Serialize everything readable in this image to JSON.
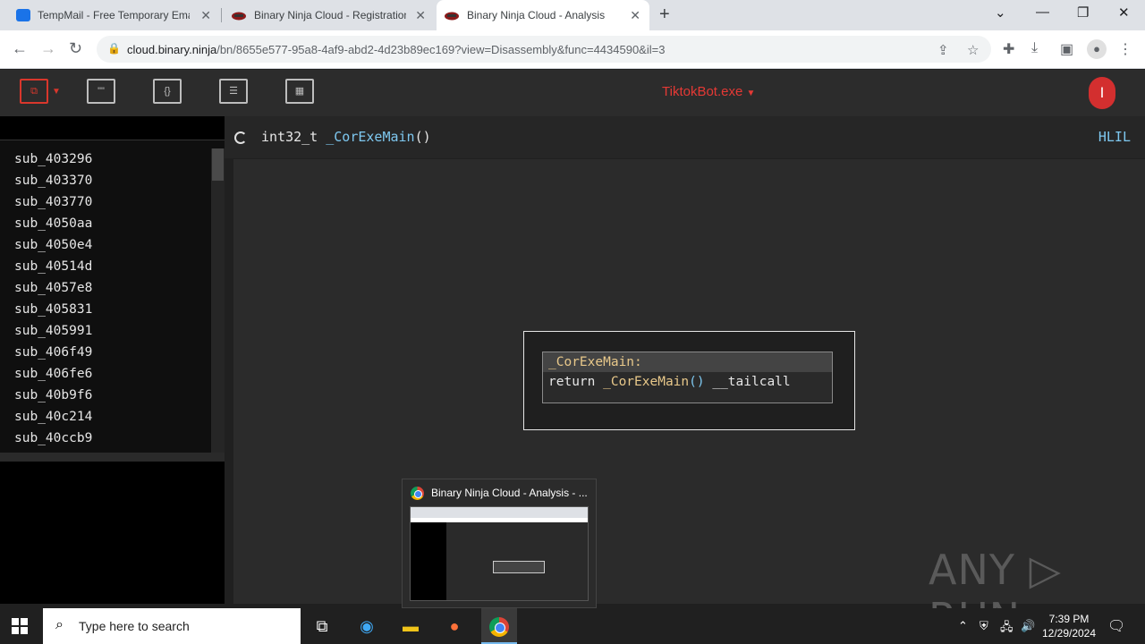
{
  "browser": {
    "tabs": [
      {
        "title": "TempMail - Free Temporary Ema",
        "icon": "mail-icon"
      },
      {
        "title": "Binary Ninja Cloud - Registration",
        "icon": "binja-icon"
      },
      {
        "title": "Binary Ninja Cloud - Analysis",
        "icon": "binja-icon",
        "active": true
      }
    ],
    "url_host": "cloud.binary.ninja",
    "url_path": "/bn/8655e577-95a8-4af9-abd2-4d23b89ec169?view=Disassembly&func=4434590&il=3"
  },
  "app": {
    "filename": "TiktokBot.exe",
    "user_initial": "I",
    "accent_color": "#d9372c",
    "function_list": [
      "sub_403296",
      "sub_403370",
      "sub_403770",
      "sub_4050aa",
      "sub_4050e4",
      "sub_40514d",
      "sub_4057e8",
      "sub_405831",
      "sub_405991",
      "sub_406f49",
      "sub_406fe6",
      "sub_40b9f6",
      "sub_40c214",
      "sub_40ccb9"
    ],
    "function_signature": {
      "ret_type": "int32_t ",
      "name": "_CorExeMain",
      "params": "()"
    },
    "il_level": "HLIL",
    "graph_node": {
      "label": "_CorExeMain:",
      "code_kw": "return ",
      "code_fn": "_CorExeMain",
      "code_par": "()",
      "code_tail": " __tailcall"
    }
  },
  "preview": {
    "title": "Binary Ninja Cloud - Analysis - ..."
  },
  "watermark": "ANY ▷ RUN",
  "taskbar": {
    "search_placeholder": "Type here to search",
    "time": "7:39 PM",
    "date": "12/29/2024"
  }
}
